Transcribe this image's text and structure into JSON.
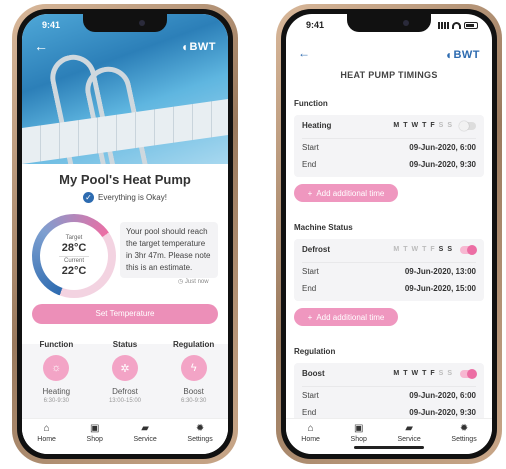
{
  "left_phone": {
    "status_time": "9:41",
    "brand": "BWT",
    "title": "My Pool's Heat Pump",
    "status_message": "Everything is Okay!",
    "gauge": {
      "target_label": "Target",
      "target_value": "28°C",
      "current_label": "Current",
      "current_value": "22°C",
      "progress_fraction": 0.6
    },
    "message": "Your pool should reach the target temperature in 3hr 47m. Please note this is an estimate.",
    "updated": "Just now",
    "set_temperature_label": "Set Temperature",
    "columns": [
      {
        "heading": "Function",
        "icon": "sun-icon",
        "name": "Heating",
        "time": "6:30-9:30"
      },
      {
        "heading": "Status",
        "icon": "snowflake-icon",
        "name": "Defrost",
        "time": "13:00-15:00"
      },
      {
        "heading": "Regulation",
        "icon": "bolt-icon",
        "name": "Boost",
        "time": "6:30-9:30"
      }
    ]
  },
  "right_phone": {
    "status_time": "9:41",
    "brand": "BWT",
    "title": "HEAT PUMP TIMINGS",
    "sections": [
      {
        "heading": "Function",
        "name": "Heating",
        "days": [
          "M",
          "T",
          "W",
          "T",
          "F",
          "S",
          "S"
        ],
        "days_active": [
          true,
          true,
          true,
          true,
          true,
          false,
          false
        ],
        "toggle_on": false,
        "start_label": "Start",
        "start_value": "09-Jun-2020, 6:00",
        "end_label": "End",
        "end_value": "09-Jun-2020, 9:30",
        "add_label": "Add additional time"
      },
      {
        "heading": "Machine Status",
        "name": "Defrost",
        "days": [
          "M",
          "T",
          "W",
          "T",
          "F",
          "S",
          "S"
        ],
        "days_active": [
          false,
          false,
          false,
          false,
          false,
          true,
          true
        ],
        "toggle_on": true,
        "start_label": "Start",
        "start_value": "09-Jun-2020, 13:00",
        "end_label": "End",
        "end_value": "09-Jun-2020, 15:00",
        "add_label": "Add additional time"
      },
      {
        "heading": "Regulation",
        "name": "Boost",
        "days": [
          "M",
          "T",
          "W",
          "T",
          "F",
          "S",
          "S"
        ],
        "days_active": [
          true,
          true,
          true,
          true,
          true,
          false,
          false
        ],
        "toggle_on": true,
        "start_label": "Start",
        "start_value": "09-Jun-2020, 6:00",
        "end_label": "End",
        "end_value": "09-Jun-2020, 9:30"
      }
    ]
  },
  "tabbar": [
    {
      "label": "Home",
      "icon": "home-icon"
    },
    {
      "label": "Shop",
      "icon": "shop-icon"
    },
    {
      "label": "Service",
      "icon": "chat-icon"
    },
    {
      "label": "Settings",
      "icon": "gear-icon"
    }
  ],
  "colors": {
    "accent_pink": "#ec8fb8",
    "brand_blue": "#2d6bb0",
    "gauge_blue": "#2d6bb0"
  }
}
